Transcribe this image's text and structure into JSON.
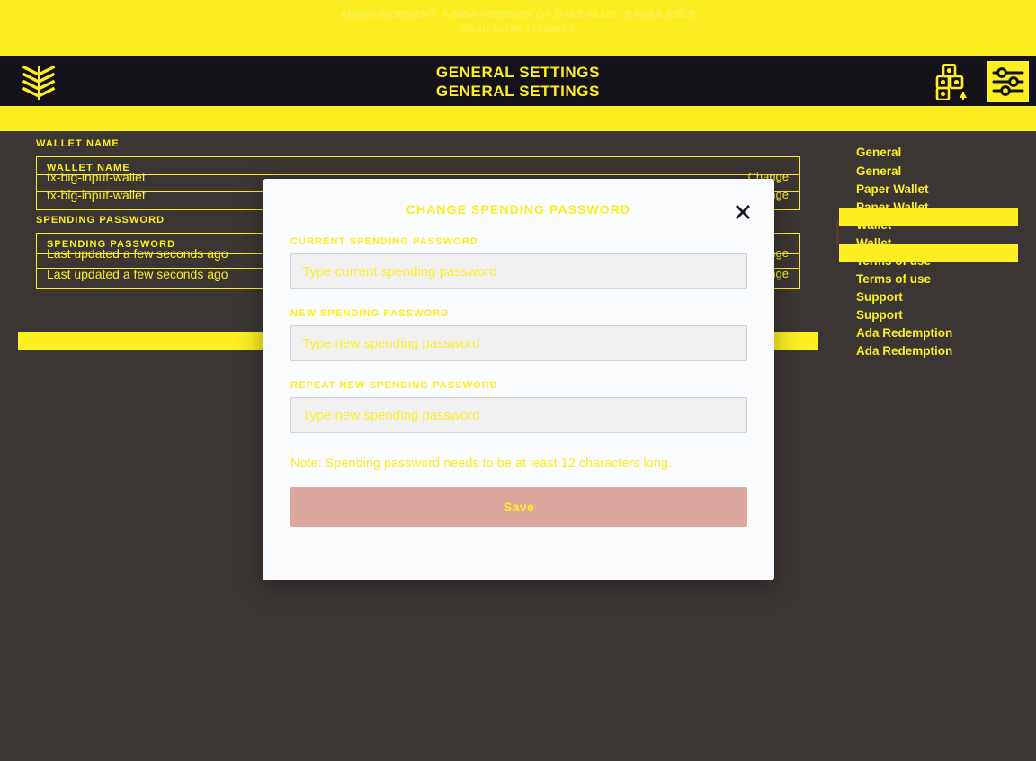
{
  "colors": {
    "accent_yellow": "#fcee21",
    "app_background": "#3b3634",
    "topbar_background": "#141218",
    "dialog_background": "#fafbfc",
    "input_background": "#f0f0f0",
    "input_border": "#ccd4dd",
    "save_button": "#dca79d",
    "close_icon": "#1a1a26"
  },
  "news_banner": {
    "line1": "ANNOUNCEMENT: A NEW VERSION OF DAEDALUS IS AVAILABLE",
    "line2": "READ MORE / DISMISS"
  },
  "topbar": {
    "logo_icon": "daedalus-chevron-logo",
    "title_line1": "GENERAL SETTINGS",
    "title_line2": "GENERAL SETTINGS",
    "apps_icon": "apps-grid-icon",
    "settings_icon": "sliders-settings-icon"
  },
  "settings_pane": {
    "fields": [
      {
        "label": "WALLET NAME",
        "label_ghost": "WALLET NAME",
        "value": "tx-big-input-wallet",
        "value_ghost": "tx-big-input-wallet",
        "action": "Change",
        "action_ghost": "Change"
      },
      {
        "label": "SPENDING PASSWORD",
        "label_ghost": "SPENDING PASSWORD",
        "value": "Last updated a few seconds ago",
        "value_ghost": "Last updated a few seconds ago",
        "action": "Change",
        "action_ghost": "Change"
      }
    ]
  },
  "sidebar": {
    "items": [
      {
        "label": "General"
      },
      {
        "label": "General"
      },
      {
        "label": "Paper Wallet"
      },
      {
        "label": "Paper Wallet"
      },
      {
        "label": "Wallet"
      },
      {
        "label": "Wallet"
      },
      {
        "label": "Terms of use"
      },
      {
        "label": "Terms of use"
      },
      {
        "label": "Support"
      },
      {
        "label": "Support"
      },
      {
        "label": "Ada Redemption"
      },
      {
        "label": "Ada Redemption"
      }
    ]
  },
  "dialog": {
    "title": "CHANGE SPENDING PASSWORD",
    "close_icon": "close-x-icon",
    "fields": [
      {
        "label": "CURRENT SPENDING PASSWORD",
        "placeholder": "Type current spending password",
        "value": ""
      },
      {
        "label": "NEW SPENDING PASSWORD",
        "placeholder": "Type new spending password",
        "value": ""
      },
      {
        "label": "REPEAT NEW SPENDING PASSWORD",
        "placeholder": "Type new spending password",
        "value": ""
      }
    ],
    "note": "Note: Spending password needs to be at least 12 characters long.",
    "save_label": "Save"
  }
}
